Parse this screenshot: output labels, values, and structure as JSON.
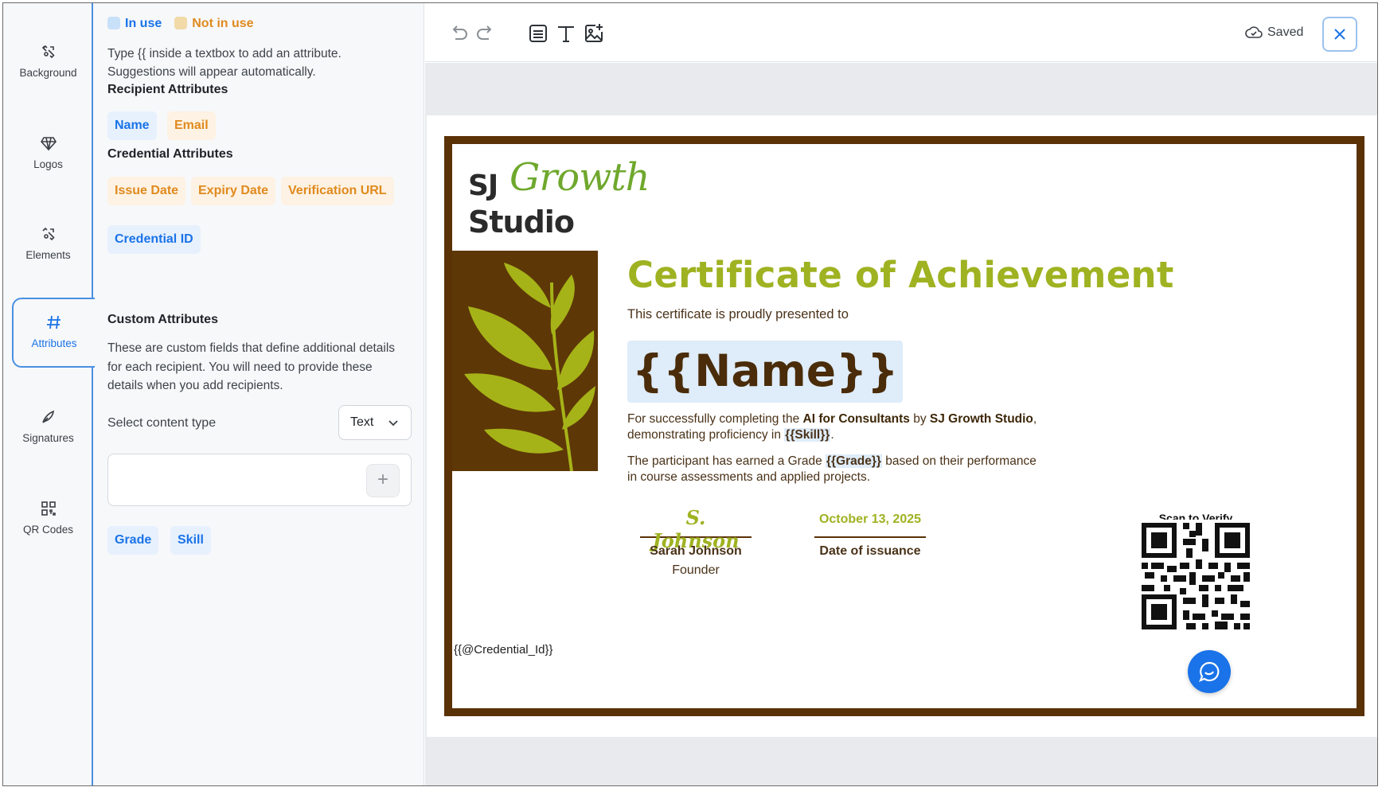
{
  "rail": {
    "items": [
      {
        "label": "Background",
        "icon": "background-icon"
      },
      {
        "label": "Logos",
        "icon": "diamond-icon"
      },
      {
        "label": "Elements",
        "icon": "elements-icon"
      },
      {
        "label": "Attributes",
        "icon": "hash-icon",
        "active": true
      },
      {
        "label": "Signatures",
        "icon": "pen-icon"
      },
      {
        "label": "QR Codes",
        "icon": "qr-code-icon"
      }
    ]
  },
  "panel": {
    "legend": {
      "in_use": "In use",
      "not_in_use": "Not in use",
      "in_use_color": "#1a73e8",
      "not_in_use_color": "#e08a1e"
    },
    "hint": "Type {{ inside a textbox to add an attribute. Suggestions will appear automatically.",
    "recipient_title": "Recipient Attributes",
    "recipient_chips": [
      "Name",
      "Email"
    ],
    "credential_title": "Credential Attributes",
    "credential_chips": [
      "Issue Date",
      "Expiry Date",
      "Verification URL",
      "Credential ID"
    ],
    "custom_title": "Custom Attributes",
    "custom_desc": "These are custom fields that define additional details for each recipient. You will need to provide these details when you add recipients.",
    "content_type_label": "Select content type",
    "content_type_value": "Text",
    "add_symbol": "+",
    "custom_chips": [
      "Grade",
      "Skill"
    ]
  },
  "toolbar": {
    "saved_label": "Saved"
  },
  "certificate": {
    "logo_line1": "SJ",
    "logo_script": "Growth",
    "logo_line2": "Studio",
    "title": "Certificate of Achievement",
    "presented": "This certificate is proudly presented to",
    "name_placeholder": "{{Name}}",
    "p1_a": "For successfully completing the ",
    "p1_b": "AI for Consultants",
    "p1_c": " by ",
    "p1_d": "SJ Growth Studio",
    "p1_e": ", demonstrating proficiency in ",
    "p1_f": "{{Skill}}",
    "p1_g": ".",
    "p2_a": "The participant has earned a Grade ",
    "p2_b": "{{Grade}}",
    "p2_c": " based on their performance in course assessments and applied projects.",
    "sig_script": "S. Johnson",
    "sig_name": "Sarah Johnson",
    "sig_role": "Founder",
    "date_value": "October 13, 2025",
    "date_label": "Date of issuance",
    "qr_label": "Scan to Verify",
    "credential_id": "{{@Credential_Id}}"
  },
  "colors": {
    "accent": "#1a73e8",
    "border_brown": "#5a3206",
    "olive": "#9fb221",
    "leaf_green": "#6fa82d"
  }
}
